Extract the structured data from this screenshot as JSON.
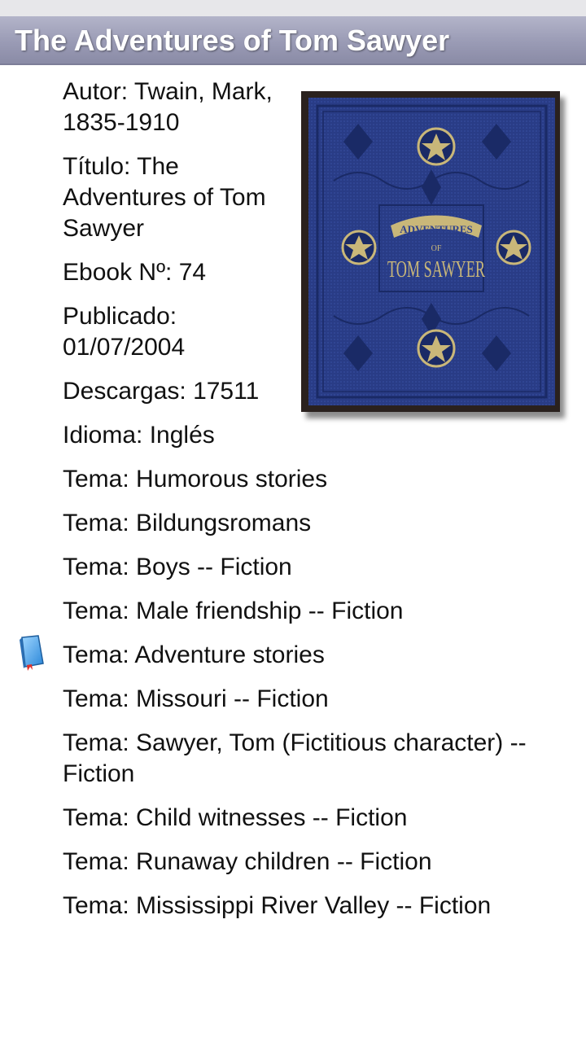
{
  "header": {
    "title": "The Adventures of Tom Sawyer"
  },
  "book": {
    "author": "Autor: Twain, Mark, 1835-1910",
    "title": "Título: The Adventures of Tom Sawyer",
    "ebook_no": "Ebook Nº: 74",
    "published": "Publicado: 01/07/2004",
    "downloads": "Descargas: 17511",
    "language": "Idioma: Inglés",
    "subjects": [
      "Tema: Humorous stories",
      "Tema: Bildungsromans",
      "Tema: Boys -- Fiction",
      "Tema: Male friendship -- Fiction",
      "Tema: Adventure stories",
      "Tema: Missouri -- Fiction",
      "Tema: Sawyer, Tom (Fictitious character) -- Fiction",
      "Tema: Child witnesses -- Fiction",
      "Tema: Runaway children -- Fiction",
      "Tema: Mississippi River Valley -- Fiction"
    ]
  },
  "cover": {
    "banner_text": "ADVENTURES",
    "of_text": "OF",
    "main_text": "TOM SAWYER",
    "colors": {
      "cloth": "#2b3f8c",
      "gold": "#c9b779",
      "frame": "#2a211e"
    }
  },
  "icons": {
    "book": "book-icon"
  }
}
